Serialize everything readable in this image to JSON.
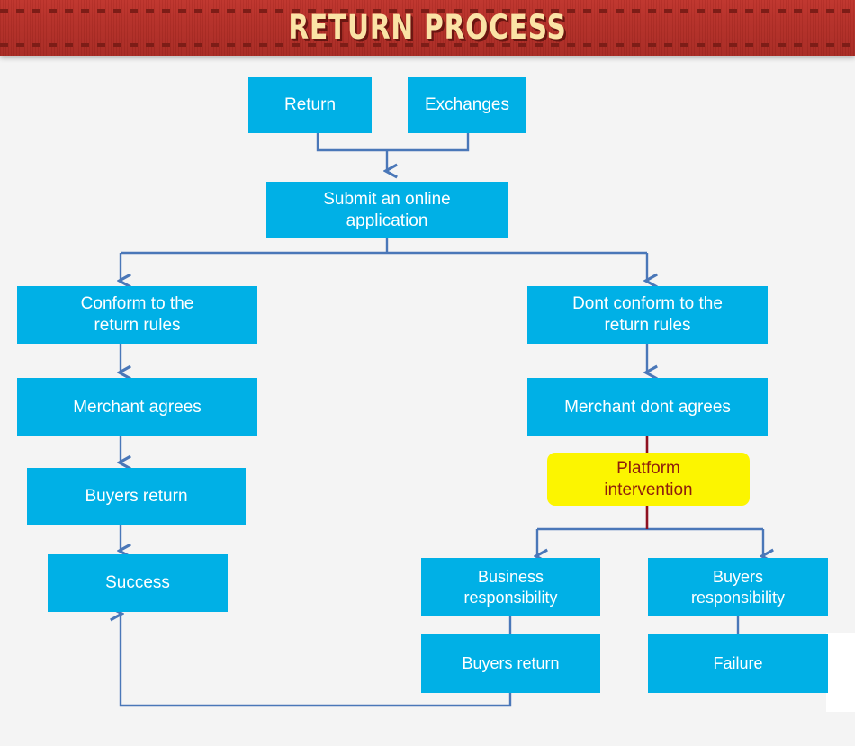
{
  "banner": {
    "title": "RETURN PROCESS",
    "background_color": "#b52f28",
    "title_color": "#fbe3a6"
  },
  "canvas": {
    "background_color": "#f4f4f4",
    "node_color": "#00b0e6",
    "node_text_color": "#ffffff",
    "highlight_color": "#fcf500",
    "highlight_text_color": "#8e1d0c",
    "connector_color": "#4a77b8",
    "highlight_connector_color": "#8e1020"
  },
  "nodes": {
    "return": "Return",
    "exchanges": "Exchanges",
    "submit": "Submit an online\napplication",
    "submit_line1": "Submit an online",
    "submit_line2": "application",
    "conform": "Conform to the\nreturn rules",
    "conform_line1": "Conform to the",
    "conform_line2": "return rules",
    "merchant_agrees": "Merchant agrees",
    "buyers_return_left": "Buyers return",
    "success": "Success",
    "dont_conform": "Dont conform to the\nreturn rules",
    "dont_conform_line1": "Dont conform to the",
    "dont_conform_line2": "return rules",
    "merchant_dont_agrees": "Merchant dont agrees",
    "platform_intervention": "Platform\nintervention",
    "platform_line1": "Platform",
    "platform_line2": "intervention",
    "business_responsibility": "Business\nresponsibility",
    "business_line1": "Business",
    "business_line2": "responsibility",
    "buyers_return_bottom": "Buyers return",
    "buyers_responsibility": "Buyers\nresponsibility",
    "buyers_resp_line1": "Buyers",
    "buyers_resp_line2": "responsibility",
    "failure": "Failure"
  },
  "flow": {
    "edges": [
      {
        "from": "return",
        "to": "submit"
      },
      {
        "from": "exchanges",
        "to": "submit"
      },
      {
        "from": "submit",
        "to": "conform"
      },
      {
        "from": "submit",
        "to": "dont_conform"
      },
      {
        "from": "conform",
        "to": "merchant_agrees"
      },
      {
        "from": "merchant_agrees",
        "to": "buyers_return_left"
      },
      {
        "from": "buyers_return_left",
        "to": "success"
      },
      {
        "from": "dont_conform",
        "to": "merchant_dont_agrees"
      },
      {
        "from": "merchant_dont_agrees",
        "to": "platform_intervention"
      },
      {
        "from": "platform_intervention",
        "to": "business_responsibility"
      },
      {
        "from": "platform_intervention",
        "to": "buyers_responsibility"
      },
      {
        "from": "business_responsibility",
        "to": "buyers_return_bottom"
      },
      {
        "from": "buyers_responsibility",
        "to": "failure"
      },
      {
        "from": "buyers_return_bottom",
        "to": "success"
      }
    ]
  }
}
